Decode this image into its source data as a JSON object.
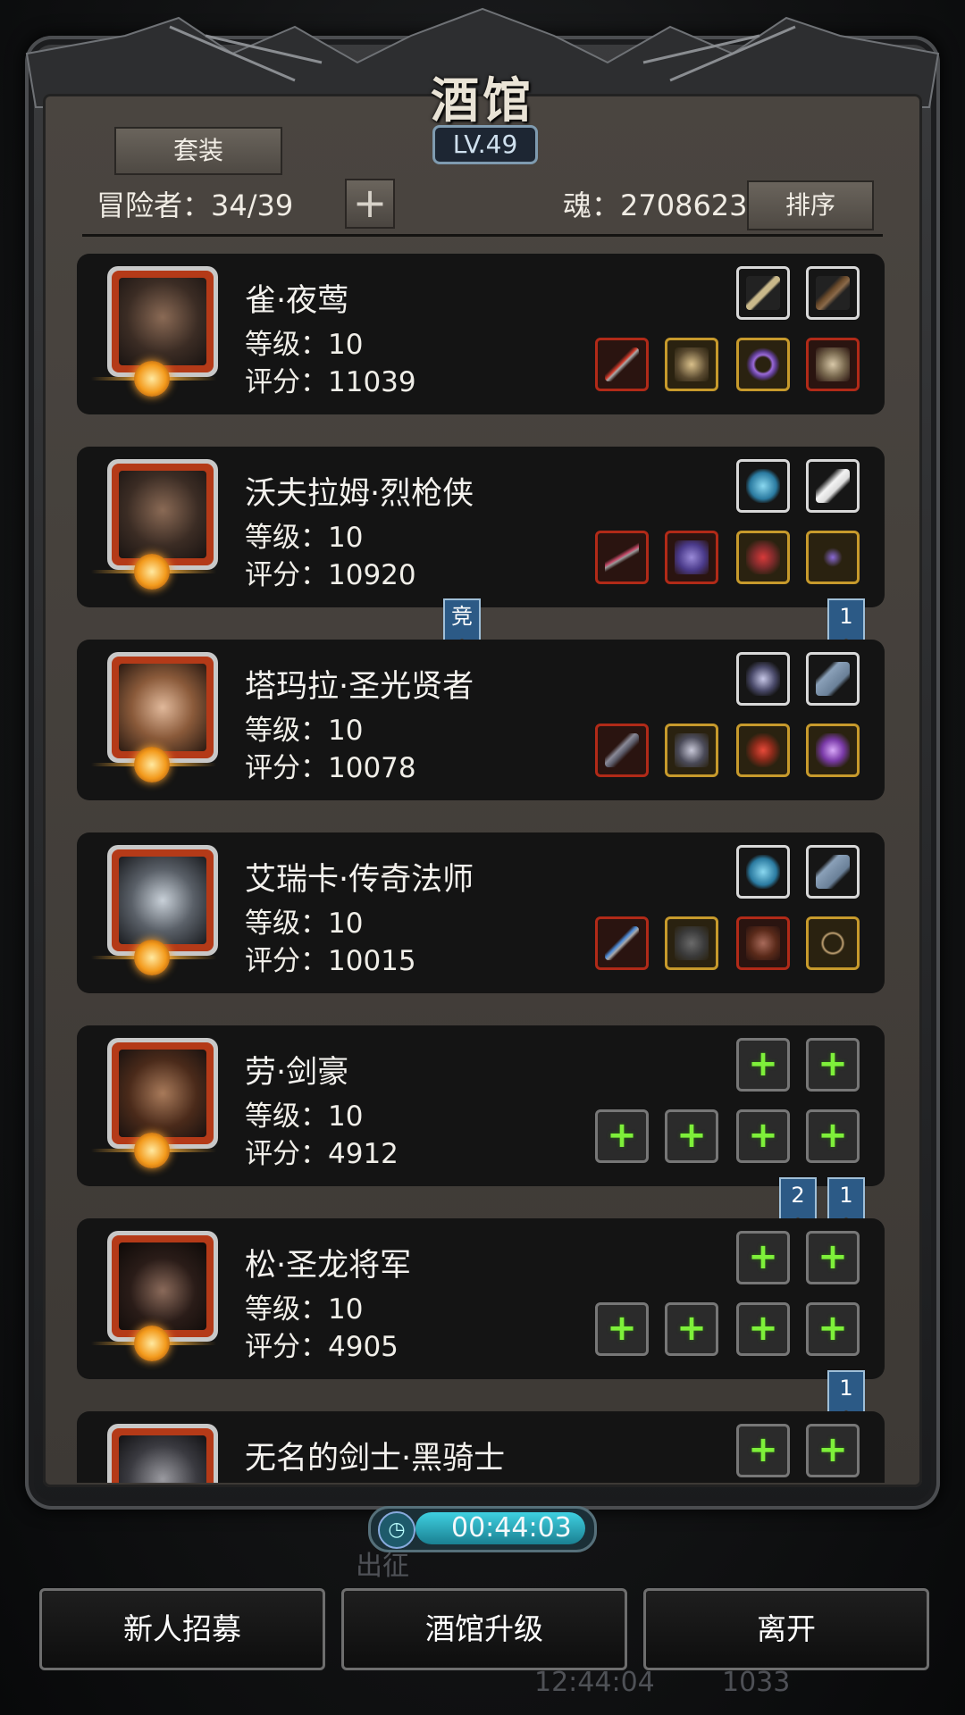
{
  "header": {
    "title": "酒馆",
    "level": "LV.49"
  },
  "toolbar": {
    "suit_label": "套装",
    "adventurers": "冒险者：34/39",
    "add_label": "+",
    "soul": "魂：2708623",
    "sort_label": "排序"
  },
  "heroes": [
    {
      "name": "雀·夜莺",
      "level": "等级：10",
      "score": "评分：11039"
    },
    {
      "name": "沃夫拉姆·烈枪侠",
      "level": "等级：10",
      "score": "评分：10920"
    },
    {
      "name": "塔玛拉·圣光贤者",
      "level": "等级：10",
      "score": "评分：10078"
    },
    {
      "name": "艾瑞卡·传奇法师",
      "level": "等级：10",
      "score": "评分：10015"
    },
    {
      "name": "劳·剑豪",
      "level": "等级：10",
      "score": "评分：4912"
    },
    {
      "name": "松·圣龙将军",
      "level": "等级：10",
      "score": "评分：4905"
    },
    {
      "name": "无名的剑士·黑骑士",
      "level": "",
      "score": ""
    }
  ],
  "badges": {
    "compete": "竞",
    "one": "1",
    "two": "2"
  },
  "timer": {
    "value": "00:44:03"
  },
  "buttons": {
    "recruit": "新人招募",
    "upgrade": "酒馆升级",
    "leave": "离开"
  },
  "background": {
    "clock": "12:44:04",
    "count": "1033",
    "departure": "出征"
  },
  "icons": [
    "clock-icon",
    "plus-icon",
    "weapon-icon",
    "armor-icon",
    "ring-icon"
  ]
}
